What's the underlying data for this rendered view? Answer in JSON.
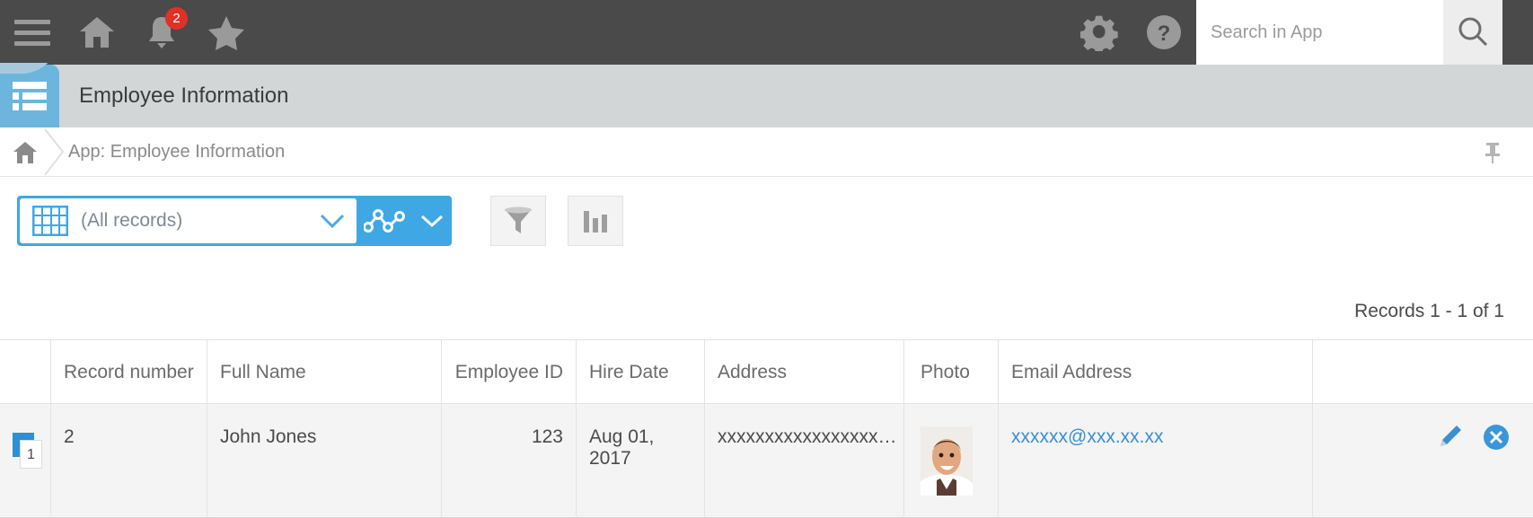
{
  "topbar": {
    "menu_icon": "hamburger-menu-icon",
    "home_icon": "home-icon",
    "notifications_icon": "bell-icon",
    "notifications_badge": "2",
    "favorites_icon": "star-icon",
    "settings_icon": "gear-icon",
    "help_icon": "help-question-icon",
    "search_placeholder": "Search in App",
    "search_value": "",
    "search_button_icon": "magnifier-icon",
    "background_color": "#4a4a4a"
  },
  "app_header": {
    "app_icon": "app-list-icon",
    "title": "Employee Information",
    "background_color": "#d2d6d7",
    "icon_color": "#6cb6de"
  },
  "breadcrumb": {
    "home_icon": "home-icon",
    "separator_icon": "chevron-right-icon",
    "path": "App: Employee Information",
    "pin_icon": "pin-icon"
  },
  "toolbar": {
    "view_selector": {
      "table_icon": "table-grid-icon",
      "label": "(All records)",
      "chevron_icon": "chevron-down-icon",
      "graph_icon": "graph-line-icon",
      "graph_chevron_icon": "chevron-down-icon",
      "accent_color": "#3ea7e4"
    },
    "filter_button": {
      "icon": "funnel-filter-icon",
      "label": ""
    },
    "chart_button": {
      "icon": "bar-chart-icon",
      "label": ""
    },
    "add_button": {
      "icon": "plus-icon",
      "label": ""
    },
    "settings_button": {
      "icon": "gear-icon",
      "label": "",
      "highlight_color": "#fb0007"
    },
    "settings_chevron": {
      "icon": "chevron-down-icon"
    },
    "more_button": {
      "icon": "ellipsis-icon",
      "label": ""
    }
  },
  "records_status": "Records 1 - 1 of 1",
  "table": {
    "columns": [
      {
        "key": "rowmark",
        "label": ""
      },
      {
        "key": "record_number",
        "label": "Record number"
      },
      {
        "key": "full_name",
        "label": "Full Name"
      },
      {
        "key": "employee_id",
        "label": "Employee ID"
      },
      {
        "key": "hire_date",
        "label": "Hire Date"
      },
      {
        "key": "address",
        "label": "Address"
      },
      {
        "key": "photo",
        "label": "Photo"
      },
      {
        "key": "email",
        "label": "Email Address"
      },
      {
        "key": "actions",
        "label": ""
      }
    ],
    "rows": [
      {
        "row_index": "1",
        "record_number": "2",
        "full_name": "John Jones",
        "employee_id": "123",
        "hire_date": "Aug 01, 2017",
        "address": "xxxxxxxxxxxxxxxxx…",
        "photo_alt": "employee-photo",
        "email": "xxxxxx@xxx.xx.xx",
        "edit_icon": "pencil-edit-icon",
        "delete_icon": "close-circle-icon"
      }
    ]
  }
}
